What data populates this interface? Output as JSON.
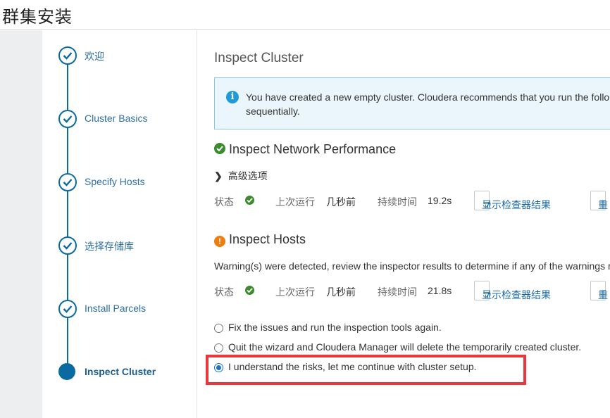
{
  "header": {
    "title": "群集安装"
  },
  "steps": [
    {
      "label": "欢迎",
      "state": "done"
    },
    {
      "label": "Cluster Basics",
      "state": "done"
    },
    {
      "label": "Specify Hosts",
      "state": "done"
    },
    {
      "label": "选择存储库",
      "state": "done"
    },
    {
      "label": "Install Parcels",
      "state": "done"
    },
    {
      "label": "Inspect Cluster",
      "state": "current"
    }
  ],
  "main": {
    "title": "Inspect Cluster",
    "info": {
      "line1": "You have created a new empty cluster. Cloudera recommends that you run the follo",
      "line2": "sequentially."
    },
    "network": {
      "title": "Inspect Network Performance",
      "advanced_label": "高级选项",
      "status_label": "状态",
      "last_run_label": "上次运行",
      "last_run_value": "几秒前",
      "duration_label": "持续时间",
      "duration_value": "19.2s",
      "show_results_label": "显示检查器结果",
      "rerun_label": "重"
    },
    "hosts": {
      "title": "Inspect Hosts",
      "warning_text": "Warning(s) were detected, review the inspector results to determine if any of the warnings n",
      "status_label": "状态",
      "last_run_label": "上次运行",
      "last_run_value": "几秒前",
      "duration_label": "持续时间",
      "duration_value": "21.8s",
      "show_results_label": "显示检查器结果",
      "rerun_label": "重"
    },
    "options": [
      {
        "label": "Fix the issues and run the inspection tools again.",
        "checked": false
      },
      {
        "label": "Quit the wizard and Cloudera Manager will delete the temporarily created cluster.",
        "checked": false
      },
      {
        "label": "I understand the risks, let me continue with cluster setup.",
        "checked": true
      }
    ]
  },
  "colors": {
    "accent": "#0a6aa1",
    "success": "#3c8a2e",
    "warning": "#ef7d0d",
    "info": "#1f9bd7",
    "highlight": "#e8373d"
  }
}
